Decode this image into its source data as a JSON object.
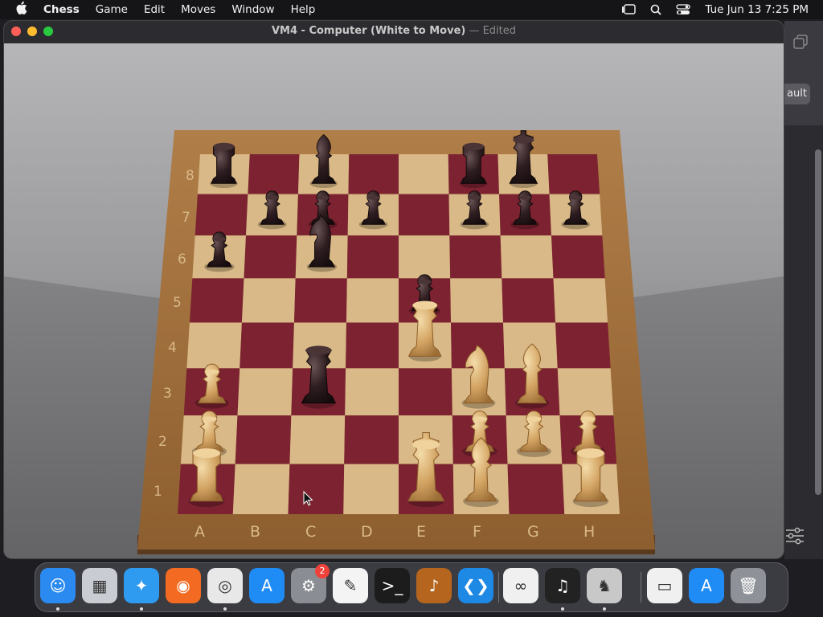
{
  "menubar": {
    "app_name": "Chess",
    "menus": [
      "Game",
      "Edit",
      "Moves",
      "Window",
      "Help"
    ],
    "clock": "Tue Jun 13  7:25 PM"
  },
  "window": {
    "title": "VM4 - Computer   (White to Move)",
    "separator": " — ",
    "status": "Edited"
  },
  "background_window": {
    "button_label": "ault"
  },
  "board": {
    "files": [
      "A",
      "B",
      "C",
      "D",
      "E",
      "F",
      "G",
      "H"
    ],
    "ranks": [
      "8",
      "7",
      "6",
      "5",
      "4",
      "3",
      "2",
      "1"
    ],
    "pieces": [
      {
        "sq": "a8",
        "type": "rook",
        "color": "black"
      },
      {
        "sq": "c8",
        "type": "bishop",
        "color": "black"
      },
      {
        "sq": "f8",
        "type": "rook",
        "color": "black"
      },
      {
        "sq": "g8",
        "type": "king",
        "color": "black"
      },
      {
        "sq": "b7",
        "type": "pawn",
        "color": "black"
      },
      {
        "sq": "c7",
        "type": "pawn",
        "color": "black"
      },
      {
        "sq": "d7",
        "type": "pawn",
        "color": "black"
      },
      {
        "sq": "f7",
        "type": "pawn",
        "color": "black"
      },
      {
        "sq": "g7",
        "type": "pawn",
        "color": "black"
      },
      {
        "sq": "h7",
        "type": "pawn",
        "color": "black"
      },
      {
        "sq": "a6",
        "type": "pawn",
        "color": "black"
      },
      {
        "sq": "c6",
        "type": "knight",
        "color": "black"
      },
      {
        "sq": "e5",
        "type": "pawn",
        "color": "black"
      },
      {
        "sq": "c3",
        "type": "queen",
        "color": "black"
      },
      {
        "sq": "e4",
        "type": "queen",
        "color": "white"
      },
      {
        "sq": "f3",
        "type": "knight",
        "color": "white"
      },
      {
        "sq": "g3",
        "type": "bishop",
        "color": "white"
      },
      {
        "sq": "a3",
        "type": "pawn",
        "color": "white"
      },
      {
        "sq": "a2",
        "type": "pawn",
        "color": "white"
      },
      {
        "sq": "f2",
        "type": "pawn",
        "color": "white"
      },
      {
        "sq": "g2",
        "type": "pawn",
        "color": "white"
      },
      {
        "sq": "h2",
        "type": "pawn",
        "color": "white"
      },
      {
        "sq": "a1",
        "type": "rook",
        "color": "white"
      },
      {
        "sq": "e1",
        "type": "king",
        "color": "white"
      },
      {
        "sq": "f1",
        "type": "bishop",
        "color": "white"
      },
      {
        "sq": "h1",
        "type": "rook",
        "color": "white"
      }
    ],
    "colors": {
      "dark_square": "#7c2231",
      "light_square": "#d9b987",
      "frame": "#a0703e",
      "black_piece": "#2a1a1c",
      "white_piece": "#d6a865"
    }
  },
  "dock": {
    "apps": [
      {
        "name": "Finder",
        "glyph": "☺",
        "color": "#2b8af0",
        "running": true
      },
      {
        "name": "Launchpad",
        "glyph": "▦",
        "color": "#c9ccd2",
        "running": false
      },
      {
        "name": "Safari",
        "glyph": "✦",
        "color": "#2e9bf0",
        "running": true
      },
      {
        "name": "Firefox",
        "glyph": "◉",
        "color": "#f36b22",
        "running": false
      },
      {
        "name": "Chrome",
        "glyph": "◎",
        "color": "#e8e8e8",
        "running": true
      },
      {
        "name": "App Store",
        "glyph": "A",
        "color": "#1f8cf5",
        "running": false
      },
      {
        "name": "System Settings",
        "glyph": "⚙",
        "color": "#8a8d93",
        "running": false,
        "badge": "2"
      },
      {
        "name": "TextEdit",
        "glyph": "✎",
        "color": "#f4f4f4",
        "running": false
      },
      {
        "name": "Terminal",
        "glyph": ">_",
        "color": "#1c1c1c",
        "running": false
      },
      {
        "name": "GarageBand",
        "glyph": "♪",
        "color": "#b5651d",
        "running": false
      },
      {
        "name": "VS Code",
        "glyph": "❮❯",
        "color": "#1e88e5",
        "running": false
      },
      {
        "name": "Visual Studio",
        "glyph": "∞",
        "color": "#f0f0f0",
        "running": false
      },
      {
        "name": "Piano",
        "glyph": "♫",
        "color": "#222222",
        "running": true
      },
      {
        "name": "Chess",
        "glyph": "♞",
        "color": "#c8c8c8",
        "running": true
      },
      {
        "name": "Chrome Window",
        "glyph": "▭",
        "color": "#f0f0f0",
        "running": false
      },
      {
        "name": "App Store Download",
        "glyph": "A",
        "color": "#1f8cf5",
        "running": false
      },
      {
        "name": "Trash",
        "glyph": "🗑",
        "color": "#8e9197",
        "running": false
      }
    ]
  }
}
